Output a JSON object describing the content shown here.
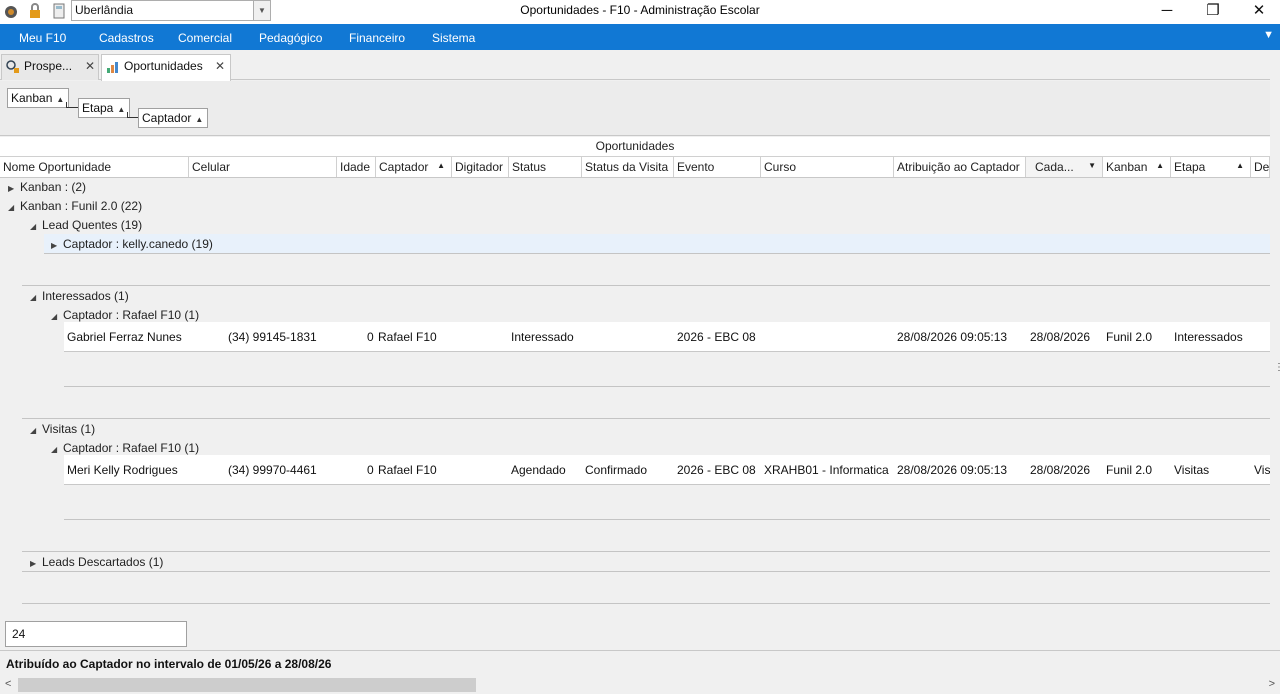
{
  "window": {
    "title": "Oportunidades - F10 - Administração Escolar",
    "city": "Uberlândia"
  },
  "menu": [
    "Meu F10",
    "Cadastros",
    "Comercial",
    "Pedagógico",
    "Financeiro",
    "Sistema"
  ],
  "tabs": [
    {
      "label": "Prospe..."
    },
    {
      "label": "Oportunidades"
    }
  ],
  "groupby": [
    "Kanban",
    "Etapa",
    "Captador"
  ],
  "band": "Oportunidades",
  "columns": [
    "Nome Oportunidade",
    "Celular",
    "Idade",
    "Captador",
    "Digitador",
    "Status",
    "Status da Visita",
    "Evento",
    "Curso",
    "Atribuição ao Captador",
    "Cada...",
    "Kanban",
    "Etapa",
    "De"
  ],
  "groups": {
    "g1": "Kanban :  (2)",
    "g2": "Kanban : Funil 2.0 (22)",
    "g3": "Lead Quentes (19)",
    "g4": "Captador : kelly.canedo (19)",
    "g5": "Interessados (1)",
    "g6": "Captador : Rafael F10 (1)",
    "g7": "Visitas (1)",
    "g8": "Captador : Rafael F10 (1)",
    "g9": "Leads Descartados (1)"
  },
  "rows": [
    {
      "nome": "Gabriel Ferraz Nunes",
      "celular": "(34) 99145-1831",
      "idade": "0",
      "captador": "Rafael F10",
      "status": "Interessado",
      "status_visita": "",
      "evento": "2026 - EBC 08",
      "curso": "",
      "atribuicao": "28/08/2026 09:05:13",
      "cadastro": "28/08/2026",
      "kanban": "Funil 2.0",
      "etapa": "Interessados",
      "extra": ""
    },
    {
      "nome": "Meri Kelly Rodrigues",
      "celular": "(34) 99970-4461",
      "idade": "0",
      "captador": "Rafael F10",
      "status": "Agendado",
      "status_visita": "Confirmado",
      "evento": "2026 - EBC 08",
      "curso": "XRAHB01 - Informatica",
      "atribuicao": "28/08/2026 09:05:13",
      "cadastro": "28/08/2026",
      "kanban": "Funil 2.0",
      "etapa": "Visitas",
      "extra": "Vis"
    }
  ],
  "footer": {
    "count": "24",
    "status": "Atribuído ao Captador no intervalo de 01/05/26 a 28/08/26"
  }
}
